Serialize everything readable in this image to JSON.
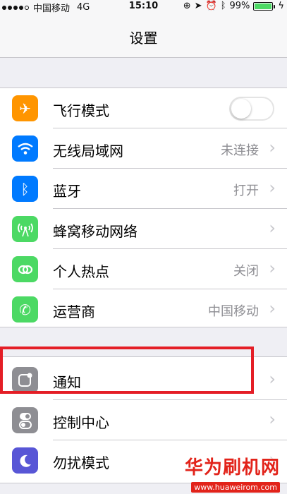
{
  "status_bar": {
    "carrier": "中国移动",
    "network": "4G",
    "time": "15:10",
    "battery": "99%"
  },
  "nav": {
    "title": "设置"
  },
  "group1": [
    {
      "label": "飞行模式",
      "icon": "airplane-icon",
      "color": "#ff9500",
      "accessory": "toggle",
      "toggle_on": false
    },
    {
      "label": "无线局域网",
      "icon": "wifi-icon",
      "color": "#007aff",
      "value": "未连接"
    },
    {
      "label": "蓝牙",
      "icon": "bluetooth-icon",
      "color": "#007aff",
      "value": "打开"
    },
    {
      "label": "蜂窝移动网络",
      "icon": "cellular-icon",
      "color": "#4cd964",
      "value": ""
    },
    {
      "label": "个人热点",
      "icon": "hotspot-icon",
      "color": "#4cd964",
      "value": "关闭"
    },
    {
      "label": "运营商",
      "icon": "phone-icon",
      "color": "#4cd964",
      "value": "中国移动"
    }
  ],
  "group2": [
    {
      "label": "通知",
      "icon": "notifications-icon",
      "color": "#8e8e93",
      "value": ""
    },
    {
      "label": "控制中心",
      "icon": "control-center-icon",
      "color": "#8e8e93",
      "value": ""
    },
    {
      "label": "勿扰模式",
      "icon": "do-not-disturb-icon",
      "color": "#5856d6",
      "value": ""
    }
  ],
  "watermark": {
    "title": "华为刷机网",
    "url": "www.huaweirom.com"
  },
  "colors": {
    "highlight": "#e41e26",
    "background": "#efeff4"
  }
}
